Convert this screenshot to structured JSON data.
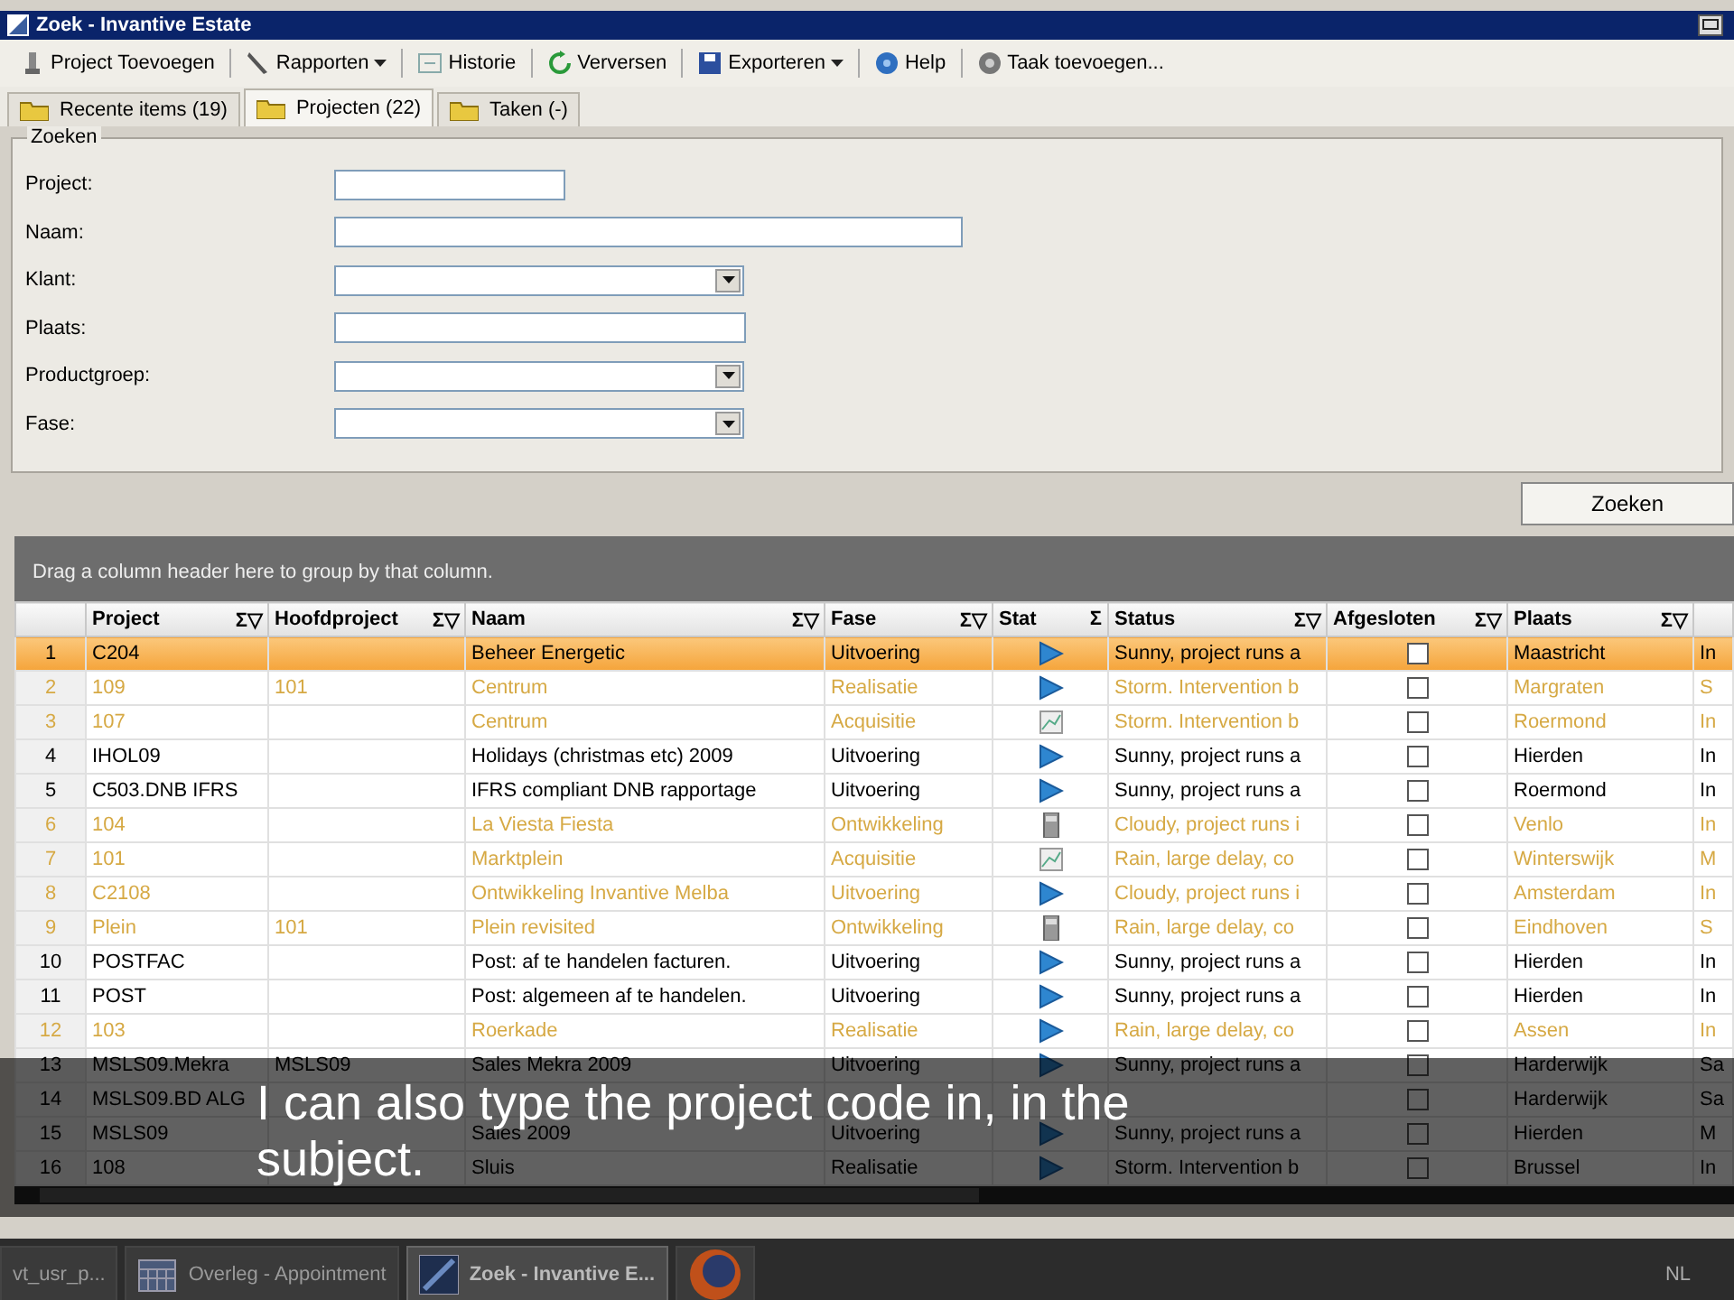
{
  "window": {
    "title": "Zoek - Invantive Estate"
  },
  "toolbar": [
    {
      "label": "Project Toevoegen",
      "dropdown": false
    },
    {
      "label": "Rapporten",
      "dropdown": true
    },
    {
      "label": "Historie",
      "dropdown": false
    },
    {
      "label": "Verversen",
      "dropdown": false
    },
    {
      "label": "Exporteren",
      "dropdown": true
    },
    {
      "label": "Help",
      "dropdown": false
    },
    {
      "label": "Taak toevoegen...",
      "dropdown": false
    }
  ],
  "tabs": [
    {
      "label": "Recente items (19)",
      "selected": false
    },
    {
      "label": "Projecten (22)",
      "selected": true
    },
    {
      "label": "Taken (-)",
      "selected": false
    }
  ],
  "search": {
    "title": "Zoeken",
    "fields": [
      {
        "label": "Project:",
        "kind": "text"
      },
      {
        "label": "Naam:",
        "kind": "text"
      },
      {
        "label": "Klant:",
        "kind": "combo"
      },
      {
        "label": "Plaats:",
        "kind": "text"
      },
      {
        "label": "Productgroep:",
        "kind": "combo"
      },
      {
        "label": "Fase:",
        "kind": "combo"
      }
    ],
    "button": "Zoeken"
  },
  "grid": {
    "group_hint": "Drag a column header here to group by that column.",
    "columns": [
      {
        "label": "Project",
        "sum": "Σ",
        "filter": "▽"
      },
      {
        "label": "Hoofdproject",
        "sum": "Σ",
        "filter": "▽"
      },
      {
        "label": "Naam",
        "sum": "Σ",
        "filter": "▽"
      },
      {
        "label": "Fase",
        "sum": "Σ",
        "filter": "▽"
      },
      {
        "label": "Stat",
        "sum": "Σ"
      },
      {
        "label": "Status",
        "sum": "Σ",
        "filter": "▽"
      },
      {
        "label": "Afgesloten",
        "sum": "Σ",
        "filter": "▽"
      },
      {
        "label": "Plaats",
        "sum": "Σ",
        "filter": "▽"
      }
    ],
    "rows": [
      {
        "number": "1",
        "selected": true,
        "color": "#000000",
        "project": "C204",
        "naam": "Beheer Energetic",
        "fase": "Uitvoering",
        "stat": {
          "kind": "play"
        },
        "status": "Sunny, project runs a",
        "afgesloten": false,
        "plaats": "Maastricht",
        "column_10": "In"
      },
      {
        "number": "2",
        "selected": false,
        "color": "#d6a944",
        "project": "109",
        "hoofdproject": "101",
        "naam": "Centrum",
        "fase": "Realisatie",
        "stat": {
          "kind": "play"
        },
        "status": "Storm. Intervention b",
        "afgesloten": false,
        "plaats": "Margraten",
        "column_10": "S"
      },
      {
        "number": "3",
        "selected": false,
        "color": "#d6a944",
        "project": "107",
        "naam": "Centrum",
        "fase": "Acquisitie",
        "stat": {
          "kind": "chart"
        },
        "status": "Storm. Intervention b",
        "afgesloten": false,
        "plaats": "Roermond",
        "column_10": "In"
      },
      {
        "number": "4",
        "selected": false,
        "color": "#000000",
        "project": "IHOL09",
        "naam": "Holidays (christmas etc) 2009",
        "fase": "Uitvoering",
        "stat": {
          "kind": "play"
        },
        "status": "Sunny, project runs a",
        "afgesloten": false,
        "plaats": "Hierden",
        "column_10": "In"
      },
      {
        "number": "5",
        "selected": false,
        "color": "#000000",
        "project": "C503.DNB IFRS",
        "naam": "IFRS compliant DNB rapportage",
        "fase": "Uitvoering",
        "stat": {
          "kind": "play"
        },
        "status": "Sunny, project runs a",
        "afgesloten": false,
        "plaats": "Roermond",
        "column_10": "In"
      },
      {
        "number": "6",
        "selected": false,
        "color": "#d6a944",
        "project": "104",
        "naam": "La Viesta Fiesta",
        "fase": "Ontwikkeling",
        "stat": {
          "kind": "device"
        },
        "status": "Cloudy, project runs i",
        "afgesloten": false,
        "plaats": "Venlo",
        "column_10": "In"
      },
      {
        "number": "7",
        "selected": false,
        "color": "#d6a944",
        "project": "101",
        "naam": "Marktplein",
        "fase": "Acquisitie",
        "stat": {
          "kind": "chart"
        },
        "status": "Rain, large delay, co",
        "afgesloten": false,
        "plaats": "Winterswijk",
        "column_10": "M"
      },
      {
        "number": "8",
        "selected": false,
        "color": "#d6a944",
        "project": "C2108",
        "naam": "Ontwikkeling Invantive Melba",
        "fase": "Uitvoering",
        "stat": {
          "kind": "play"
        },
        "status": "Cloudy, project runs i",
        "afgesloten": false,
        "plaats": "Amsterdam",
        "column_10": "In"
      },
      {
        "number": "9",
        "selected": false,
        "color": "#d6a944",
        "project": "Plein",
        "hoofdproject": "101",
        "naam": "Plein revisited",
        "fase": "Ontwikkeling",
        "stat": {
          "kind": "device"
        },
        "status": "Rain, large delay, co",
        "afgesloten": false,
        "plaats": "Eindhoven",
        "column_10": "S"
      },
      {
        "number": "10",
        "selected": false,
        "color": "#000000",
        "project": "POSTFAC",
        "naam": "Post: af te handelen facturen.",
        "fase": "Uitvoering",
        "stat": {
          "kind": "play"
        },
        "status": "Sunny, project runs a",
        "afgesloten": false,
        "plaats": "Hierden",
        "column_10": "In"
      },
      {
        "number": "11",
        "selected": false,
        "color": "#000000",
        "project": "POST",
        "naam": "Post: algemeen af te handelen.",
        "fase": "Uitvoering",
        "stat": {
          "kind": "play"
        },
        "status": "Sunny, project runs a",
        "afgesloten": false,
        "plaats": "Hierden",
        "column_10": "In"
      },
      {
        "number": "12",
        "selected": false,
        "color": "#d6a944",
        "project": "103",
        "naam": "Roerkade",
        "fase": "Realisatie",
        "stat": {
          "kind": "play"
        },
        "status": "Rain, large delay, co",
        "afgesloten": false,
        "plaats": "Assen",
        "column_10": "In"
      },
      {
        "number": "13",
        "selected": false,
        "color": "#000000",
        "project": "MSLS09.Mekra",
        "hoofdproject": "MSLS09",
        "naam": "Sales Mekra 2009",
        "fase": "Uitvoering",
        "stat": {
          "kind": "play"
        },
        "status": "Sunny, project runs a",
        "afgesloten": false,
        "plaats": "Harderwijk",
        "column_10": "Sa"
      },
      {
        "number": "14",
        "selected": false,
        "color": "#000000",
        "project": "MSLS09.BD ALG",
        "afgesloten": false,
        "plaats": "Harderwijk",
        "column_10": "Sa"
      },
      {
        "number": "15",
        "selected": false,
        "color": "#000000",
        "project": "MSLS09",
        "naam": "Sales 2009",
        "fase": "Uitvoering",
        "stat": {
          "kind": "play"
        },
        "status": "Sunny, project runs a",
        "afgesloten": false,
        "plaats": "Hierden",
        "column_10": "M"
      },
      {
        "number": "16",
        "selected": false,
        "color": "#000000",
        "project": "108",
        "naam": "Sluis",
        "fase": "Realisatie",
        "stat": {
          "kind": "play"
        },
        "status": "Storm. Intervention b",
        "afgesloten": false,
        "plaats": "Brussel",
        "column_10": "In"
      }
    ]
  },
  "subtitle_lines": [
    "I can also type the project code in, in the",
    "subject."
  ],
  "taskbar": {
    "items": [
      {
        "label": "vt_usr_p...",
        "selected": false
      },
      {
        "label": "Overleg - Appointment",
        "selected": false
      },
      {
        "label": "Zoek - Invantive E...",
        "selected": true
      },
      {
        "selected": false
      }
    ],
    "language": "NL"
  }
}
